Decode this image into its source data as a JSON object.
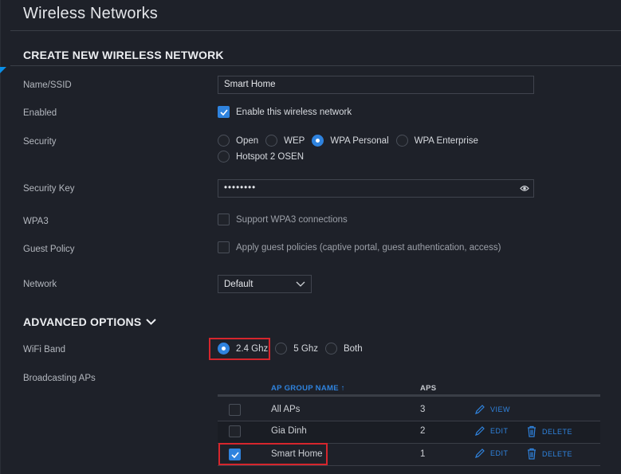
{
  "page": {
    "title": "Wireless Networks"
  },
  "create": {
    "section_title": "CREATE NEW WIRELESS NETWORK",
    "ssid": {
      "label": "Name/SSID",
      "value": "Smart Home"
    },
    "enabled": {
      "label": "Enabled",
      "text": "Enable this wireless network",
      "checked": true
    },
    "security": {
      "label": "Security",
      "options": [
        "Open",
        "WEP",
        "WPA Personal",
        "WPA Enterprise",
        "Hotspot 2 OSEN"
      ],
      "selected": "WPA Personal"
    },
    "key": {
      "label": "Security Key",
      "value": "••••••••"
    },
    "wpa3": {
      "label": "WPA3",
      "text": "Support WPA3 connections",
      "checked": false
    },
    "guest": {
      "label": "Guest Policy",
      "text": "Apply guest policies (captive portal, guest authentication, access)",
      "checked": false
    },
    "network": {
      "label": "Network",
      "value": "Default"
    }
  },
  "advanced": {
    "section_title": "ADVANCED OPTIONS",
    "band": {
      "label": "WiFi Band",
      "options": [
        "2.4 Ghz",
        "5 Ghz",
        "Both"
      ],
      "selected": "2.4 Ghz"
    },
    "aps": {
      "label": "Broadcasting APs",
      "columns": {
        "name": "AP GROUP NAME ↑",
        "aps": "APS"
      },
      "rows": [
        {
          "name": "All APs",
          "count": "3",
          "checked": false,
          "actions": [
            "VIEW"
          ]
        },
        {
          "name": "Gia Dinh",
          "count": "2",
          "checked": false,
          "actions": [
            "EDIT",
            "DELETE"
          ]
        },
        {
          "name": "Smart Home",
          "count": "1",
          "checked": true,
          "actions": [
            "EDIT",
            "DELETE"
          ]
        }
      ]
    }
  },
  "colors": {
    "accent": "#2f83de",
    "highlight": "#d6262d",
    "background": "#1e2129"
  },
  "icons": [
    "eye-icon",
    "chevron-down-icon",
    "pencil-icon",
    "trash-icon",
    "checkmark-icon",
    "sort-arrow-icon"
  ]
}
